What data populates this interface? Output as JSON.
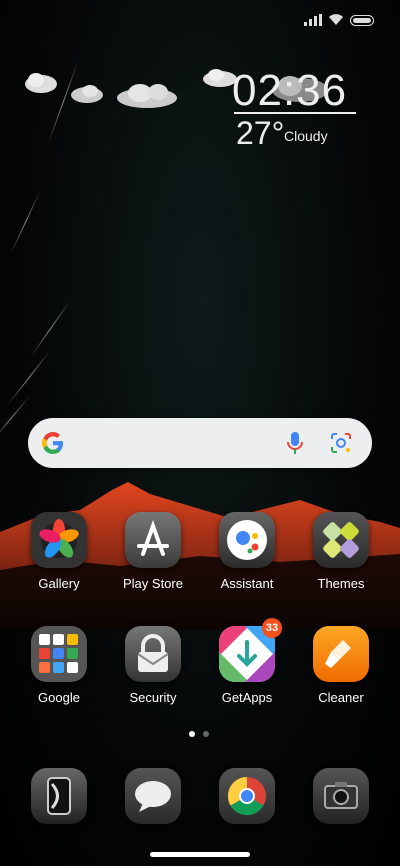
{
  "status": {
    "icons": [
      "signal-icon",
      "wifi-icon",
      "battery-icon"
    ]
  },
  "widget": {
    "time": "02:36",
    "temperature": "27°",
    "condition": "Cloudy"
  },
  "search": {
    "icons": [
      "google-g-icon",
      "microphone-icon",
      "google-lens-icon"
    ]
  },
  "row1": [
    {
      "label": "Gallery",
      "icon": "gallery-icon"
    },
    {
      "label": "Play Store",
      "icon": "play-store-icon"
    },
    {
      "label": "Assistant",
      "icon": "assistant-icon"
    },
    {
      "label": "Themes",
      "icon": "themes-icon"
    }
  ],
  "row2": [
    {
      "label": "Google",
      "icon": "google-folder-icon"
    },
    {
      "label": "Security",
      "icon": "security-icon"
    },
    {
      "label": "GetApps",
      "icon": "getapps-icon",
      "badge": "33"
    },
    {
      "label": "Cleaner",
      "icon": "cleaner-icon"
    }
  ],
  "dock": [
    {
      "icon": "phone-icon"
    },
    {
      "icon": "messages-icon"
    },
    {
      "icon": "chrome-icon"
    },
    {
      "icon": "camera-icon"
    }
  ],
  "pager": {
    "current": 1,
    "total": 2
  }
}
